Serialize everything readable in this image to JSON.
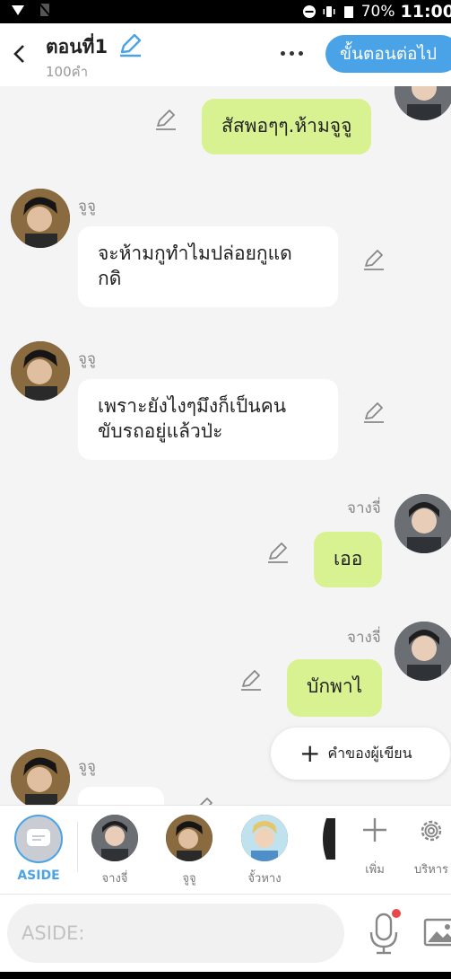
{
  "status_bar": {
    "battery": "70%",
    "time": "11:00"
  },
  "header": {
    "title": "ตอนที่1",
    "word_count": "100คำ",
    "next_label": "ขั้นตอนต่อไป"
  },
  "messages": [
    {
      "side": "right",
      "speaker": "",
      "text": "สัสพอๆๆ.ห้ามจูจู"
    },
    {
      "side": "left",
      "speaker": "จูจู",
      "lines": [
        "จะห้ามกูทำไมปล่อยกูแด",
        "กดิ"
      ]
    },
    {
      "side": "left",
      "speaker": "จูจู",
      "lines": [
        "เพราะยังไงๆมึงก็เป็นคน",
        "ขับรถอยู่แล้วป่ะ"
      ]
    },
    {
      "side": "right",
      "speaker": "จางจี่",
      "text": "เออ"
    },
    {
      "side": "right",
      "speaker": "จางจี่",
      "text": "บักพาไ"
    },
    {
      "side": "left",
      "speaker": "จูจู",
      "text": ""
    }
  ],
  "fab": {
    "label": "คำของผู้เขียน"
  },
  "characters": {
    "aside_label": "ASIDE",
    "items": [
      {
        "name": "จางจี่"
      },
      {
        "name": "จูจู"
      },
      {
        "name": "จั้วหาง"
      }
    ],
    "add_label": "เพิ่ม",
    "manage_label": "บริหาร"
  },
  "composer": {
    "placeholder": "ASIDE:"
  }
}
